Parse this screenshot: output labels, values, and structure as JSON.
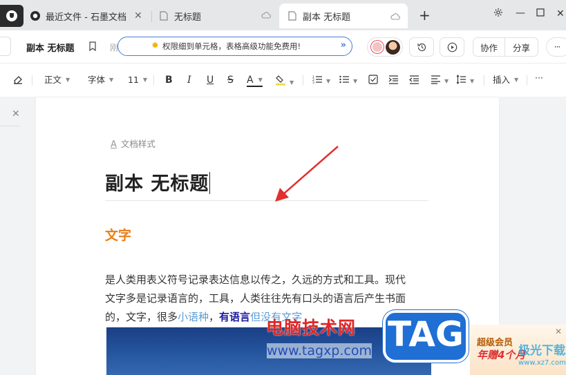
{
  "tabs": [
    {
      "label": "最近文件 - 石墨文档",
      "icon": "shimo-logo-icon"
    },
    {
      "label": "无标题",
      "icon": "document-icon"
    },
    {
      "label": "副本 无标题",
      "icon": "document-icon",
      "active": true
    }
  ],
  "docbar": {
    "title": "副本 无标题",
    "save_status": "刚刚更新,",
    "promo_text": "权限细到单元格，表格高级功能免费用!",
    "collaborate": "协作",
    "share": "分享"
  },
  "toolbar": {
    "style": "正文",
    "font": "字体",
    "size": "11",
    "bold": "B",
    "italic": "I",
    "underline": "U",
    "strike": "S",
    "font_color": "A",
    "insert": "插入",
    "more": "···"
  },
  "page": {
    "doc_style_label": "文档样式",
    "title": "副本 无标题",
    "heading": "文字",
    "para_line1": "是人类用表义符号记录表达信息以传之，久远的方式和工具。现代",
    "para_line2": "文字多是记录语言的，工具，人类往往先有口头的语言后产生书面",
    "para_line3a": "的，文字，很多",
    "para_link": "小语种",
    "para_line3b": "，",
    "para_bold": "有语言",
    "para_line3c": "但没有文字"
  },
  "watermark": {
    "site_name": "电脑技术网",
    "site_url": "www.tagxp.com",
    "tag": "TAG",
    "ad_line1": "超级会员",
    "ad_line2": "年赠4个月",
    "ad_site": "极光下载站",
    "ad_url": "www.xz7.com"
  },
  "colors": {
    "heading": "#e87e14",
    "link": "#5a9bd5",
    "promo_border": "#4a7bd8",
    "arrow": "#e03030"
  }
}
